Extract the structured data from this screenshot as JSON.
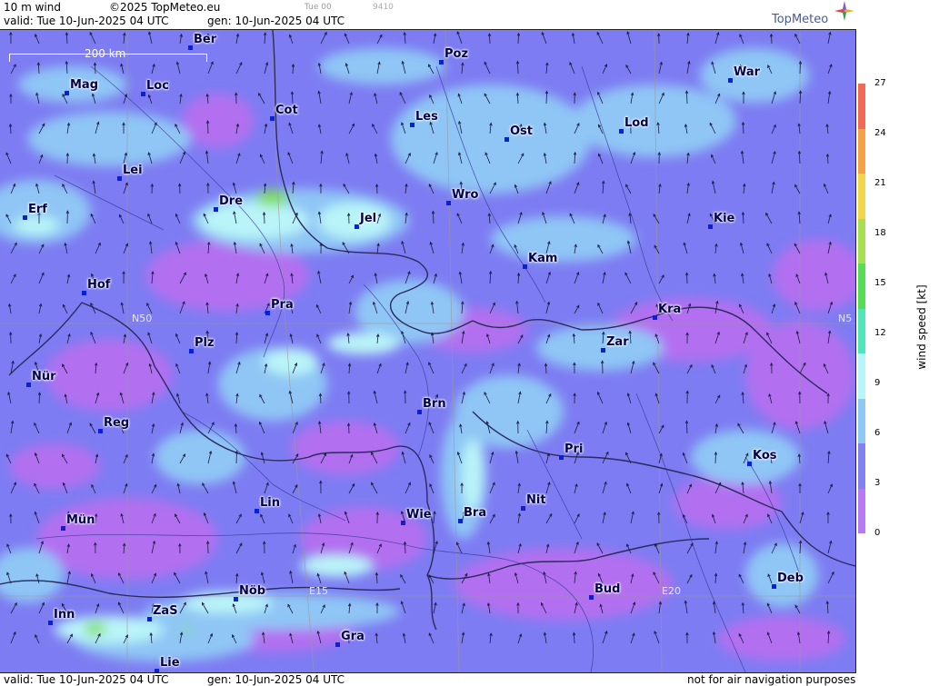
{
  "header": {
    "product": "10 m wind",
    "copyright": "©2025 TopMeteo.eu",
    "valid": "valid:  Tue  10-Jun-2025  04 UTC",
    "generated": "gen: 10-Jun-2025 04 UTC",
    "run": "Tue 00",
    "code": "9410",
    "logo": "TopMeteo"
  },
  "footer": {
    "valid": "valid:  Tue  10-Jun-2025  04 UTC",
    "generated": "gen: 10-Jun-2025 04 UTC",
    "disclaimer": "not for air navigation purposes"
  },
  "scale_bar": {
    "label": "200 km"
  },
  "grid_labels": {
    "lat_left": "N50",
    "lat_right": "N5",
    "lon_1": "E15",
    "lon_2": "E20"
  },
  "cities": [
    {
      "name": "Ber"
    },
    {
      "name": "Poz"
    },
    {
      "name": "War"
    },
    {
      "name": "Mag"
    },
    {
      "name": "Loc"
    },
    {
      "name": "Cot"
    },
    {
      "name": "Les"
    },
    {
      "name": "Ost"
    },
    {
      "name": "Lod"
    },
    {
      "name": "Lei"
    },
    {
      "name": "Erf"
    },
    {
      "name": "Dre"
    },
    {
      "name": "Jel"
    },
    {
      "name": "Wro"
    },
    {
      "name": "Kie"
    },
    {
      "name": "Kam"
    },
    {
      "name": "Hof"
    },
    {
      "name": "Pra"
    },
    {
      "name": "Kra"
    },
    {
      "name": "Zar"
    },
    {
      "name": "Plz"
    },
    {
      "name": "Nür"
    },
    {
      "name": "Brn"
    },
    {
      "name": "Reg"
    },
    {
      "name": "Pri"
    },
    {
      "name": "Kos"
    },
    {
      "name": "Lin"
    },
    {
      "name": "Nit"
    },
    {
      "name": "Mün"
    },
    {
      "name": "Wie"
    },
    {
      "name": "Bra"
    },
    {
      "name": "Deb"
    },
    {
      "name": "Nöb"
    },
    {
      "name": "Bud"
    },
    {
      "name": "Inn"
    },
    {
      "name": "ZaS"
    },
    {
      "name": "Gra"
    },
    {
      "name": "Lie"
    }
  ],
  "legend": {
    "title": "wind  speed  [kt]",
    "ticks": [
      "27",
      "24",
      "21",
      "18",
      "15",
      "12",
      "9",
      "6",
      "3",
      "0"
    ],
    "colors": [
      "#f26a55",
      "#f6a04a",
      "#f2d64a",
      "#a6e051",
      "#55dd55",
      "#4ee8b8",
      "#b8f5f8",
      "#8ec8f5",
      "#8380f2",
      "#b67af5"
    ]
  },
  "palette": {
    "base": "#7d7cf2",
    "violet": "#b270f0",
    "light_blue": "#8fc6f5",
    "cyan": "#b9f4f8",
    "green": "#7fe05a",
    "border": "#2a2a60"
  }
}
